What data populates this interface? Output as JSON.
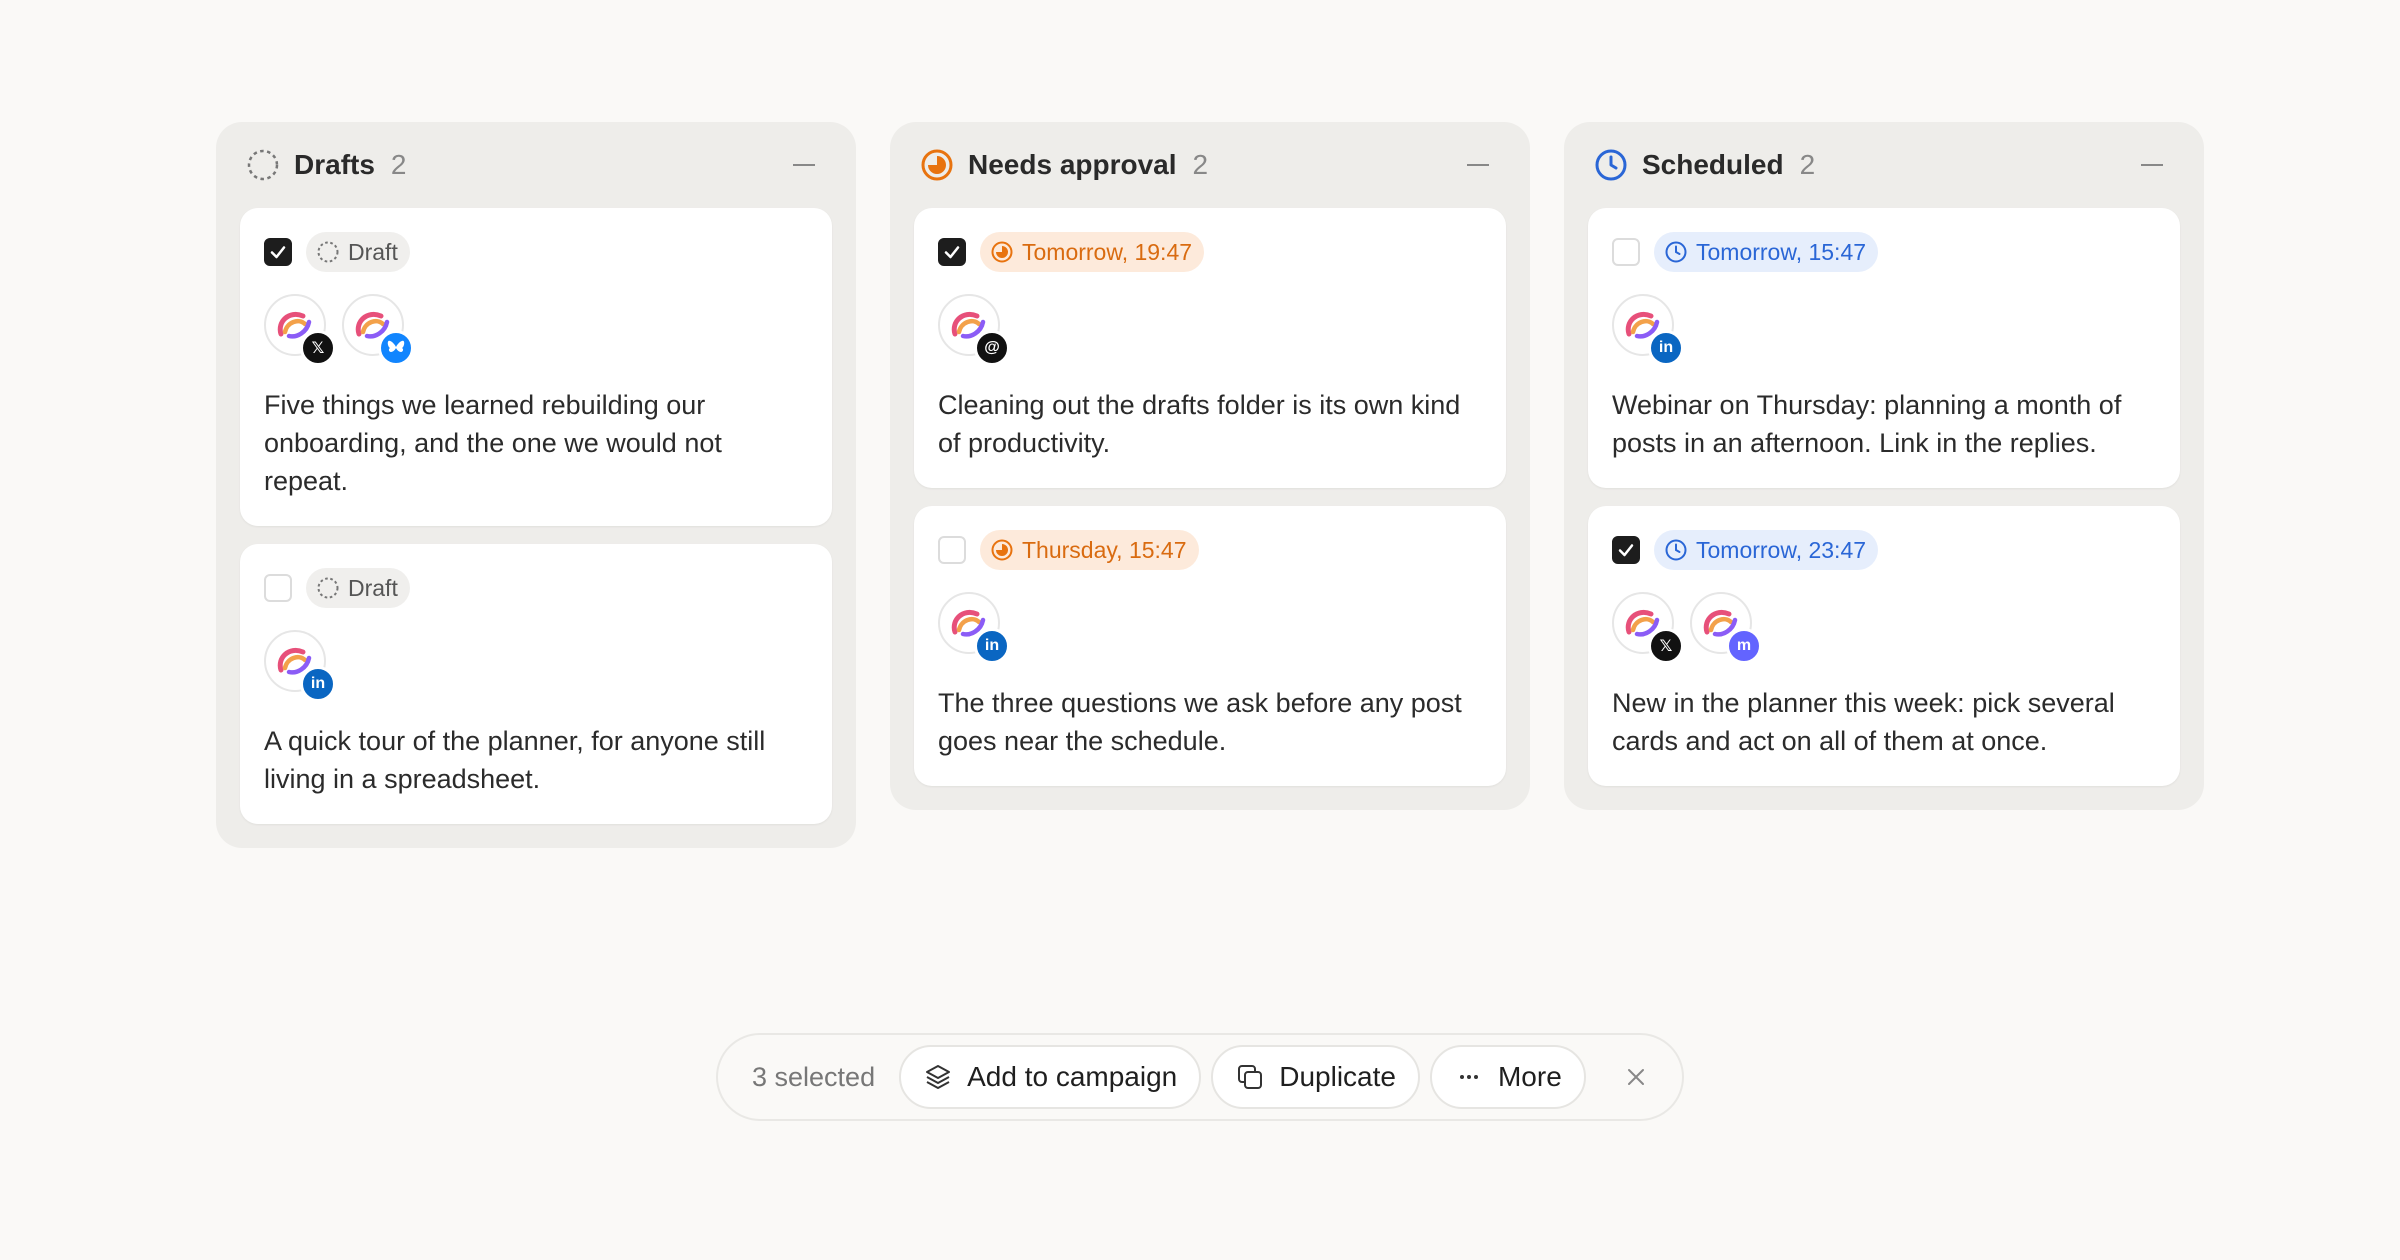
{
  "columns": [
    {
      "title": "Drafts",
      "count": "2",
      "status": "draft",
      "cards": [
        {
          "checked": true,
          "pill": "Draft",
          "networks": [
            "x",
            "bluesky"
          ],
          "text": "Five things we learned rebuilding our onboarding, and the one we would not repeat."
        },
        {
          "checked": false,
          "pill": "Draft",
          "networks": [
            "linkedin"
          ],
          "text": "A quick tour of the planner, for anyone still living in a spreadsheet."
        }
      ]
    },
    {
      "title": "Needs approval",
      "count": "2",
      "status": "approval",
      "cards": [
        {
          "checked": true,
          "pill": "Tomorrow, 19:47",
          "networks": [
            "threads"
          ],
          "text": "Cleaning out the drafts folder is its own kind of productivity."
        },
        {
          "checked": false,
          "pill": "Thursday, 15:47",
          "networks": [
            "linkedin"
          ],
          "text": "The three questions we ask before any post goes near the schedule."
        }
      ]
    },
    {
      "title": "Scheduled",
      "count": "2",
      "status": "scheduled",
      "cards": [
        {
          "checked": false,
          "pill": "Tomorrow, 15:47",
          "networks": [
            "linkedin"
          ],
          "text": "Webinar on Thursday: planning a month of posts in an afternoon. Link in the replies."
        },
        {
          "checked": true,
          "pill": "Tomorrow, 23:47",
          "networks": [
            "x",
            "mastodon"
          ],
          "text": "New in the planner this week: pick several cards and act on all of them at once."
        }
      ]
    }
  ],
  "action_bar": {
    "selected_label": "3 selected",
    "add_to_campaign": "Add to campaign",
    "duplicate": "Duplicate",
    "more": "More"
  },
  "colors": {
    "draft": "#555555",
    "approval": "#e8730f",
    "scheduled": "#2a66d6"
  },
  "icons": {
    "draft": "dashed-circle-icon",
    "approval": "half-circle-progress-icon",
    "scheduled": "clock-icon",
    "add_to_campaign": "layers-icon",
    "duplicate": "copy-icon",
    "more": "ellipsis-icon",
    "close": "close-icon"
  }
}
